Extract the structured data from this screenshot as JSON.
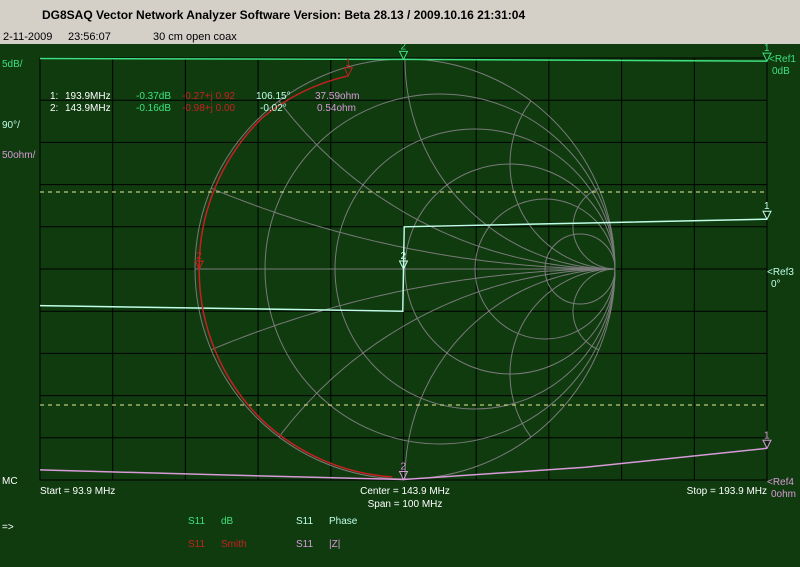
{
  "app": {
    "title": "DG8SAQ Vector Network Analyzer Software   Version:  Beta 28.13 / 2009.10.16 21:31:04",
    "date": "2-11-2009",
    "time": "23:56:07",
    "note": "30 cm open coax"
  },
  "colors": {
    "background": "#0f3b0f",
    "grid": "#000000",
    "smith_grid": "#7a7a7a",
    "s11_db": "#3fe07f",
    "s11_phase": "#c0ffe8",
    "s11_smith": "#c82020",
    "s11_z": "#d89ad8",
    "ref_line": "#e8e890"
  },
  "left_scale": {
    "db": "5dB/",
    "phase": "90°/",
    "z": "50ohm/",
    "mc": "MC",
    "arrow": "=>"
  },
  "right_refs": {
    "ref1": "<Ref1",
    "ref1_val": "0dB",
    "ref3": "<Ref3",
    "ref3_val": "0°",
    "ref4": "<Ref4",
    "ref4_val": "0ohm"
  },
  "markers": [
    {
      "id": "1:",
      "freq": "193.9MHz",
      "db": "-0.37dB",
      "smith": "-0.27+j 0.92",
      "phase": "106.15°",
      "z": "37.59ohm"
    },
    {
      "id": "2:",
      "freq": "143.9MHz",
      "db": "-0.16dB",
      "smith": "-0.98+j 0.00",
      "phase": "-0.02°",
      "z": "0.54ohm"
    }
  ],
  "freq_axis": {
    "start": "Start = 93.9 MHz",
    "center": "Center = 143.9 MHz",
    "span": "Span = 100 MHz",
    "stop": "Stop = 193.9 MHz"
  },
  "legend": [
    {
      "param": "S11",
      "mode": "dB"
    },
    {
      "param": "S11",
      "mode": "Phase"
    },
    {
      "param": "S11",
      "mode": "Smith"
    },
    {
      "param": "S11",
      "mode": "|Z|"
    }
  ],
  "marker_labels": {
    "m1": "1",
    "m2": "2"
  },
  "chart_data": {
    "type": "line",
    "x_label": "",
    "x_range": [
      93.9,
      193.9
    ],
    "x_unit": "MHz",
    "grid": true,
    "series": [
      {
        "name": "S11 dB",
        "unit": "dB",
        "ref": 0,
        "per_div": 5,
        "x": [
          93.9,
          143.9,
          193.9
        ],
        "y": [
          -0.06,
          -0.16,
          -0.37
        ]
      },
      {
        "name": "S11 Phase",
        "unit": "deg",
        "ref": 0,
        "per_div": 90,
        "x": [
          93.9,
          143.8,
          143.9,
          144.0,
          193.9
        ],
        "y": [
          -78,
          -90,
          -0.02,
          90,
          106.15
        ]
      },
      {
        "name": "S11 |Z|",
        "unit": "ohm",
        "ref": 0,
        "per_div": 50,
        "x": [
          93.9,
          118.9,
          143.9,
          168.9,
          193.9
        ],
        "y": [
          12,
          6,
          0.54,
          15,
          37.59
        ]
      },
      {
        "name": "S11 Smith",
        "unit": "gamma",
        "points": [
          [
            -0.27,
            0.92
          ],
          [
            -0.68,
            0.72
          ],
          [
            -0.98,
            0.0
          ],
          [
            -0.68,
            -0.72
          ],
          [
            -0.06,
            -0.99
          ]
        ]
      }
    ]
  }
}
